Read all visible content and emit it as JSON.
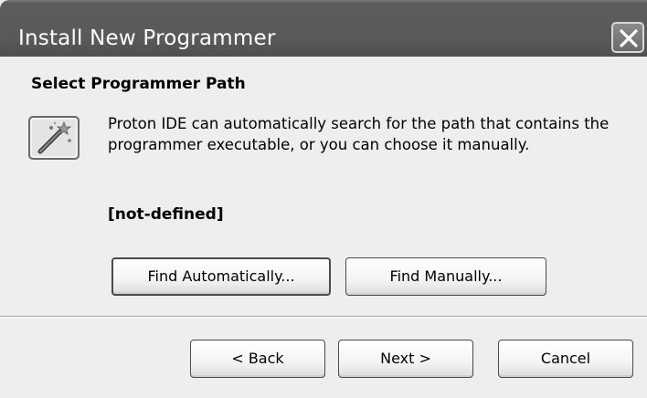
{
  "window": {
    "title": "Install New Programmer"
  },
  "page": {
    "section_title": "Select Programmer Path",
    "description": "Proton IDE can automatically search for the path that contains the programmer executable, or you can choose it manually.",
    "path_value": "[not-defined]",
    "icon": "wizard-wand-icon"
  },
  "actions": {
    "find_automatically": "Find Automatically...",
    "find_manually": "Find Manually..."
  },
  "footer": {
    "back": "< Back",
    "next": "Next >",
    "cancel": "Cancel"
  }
}
